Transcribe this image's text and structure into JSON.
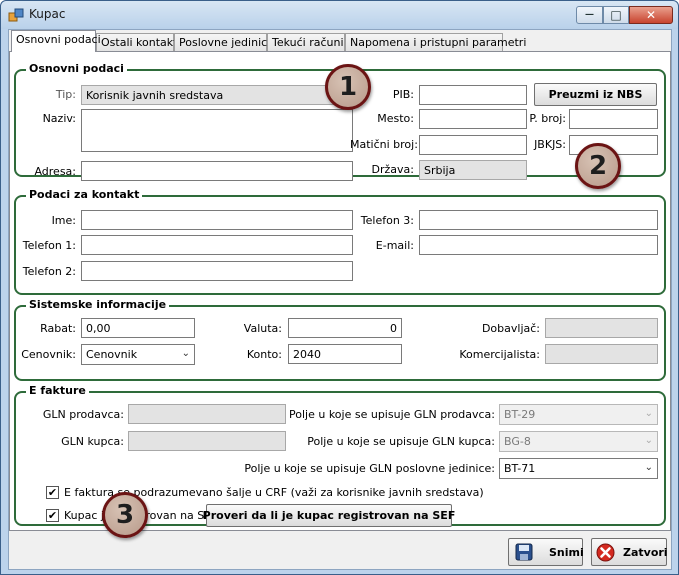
{
  "window": {
    "title": "Kupac",
    "minimize_glyph": "—",
    "maximize_glyph": "□",
    "close_glyph": "✕"
  },
  "tabs": [
    {
      "label": "Osnovni podaci",
      "active": true
    },
    {
      "label": "Ostali kontakti"
    },
    {
      "label": "Poslovne jedinice"
    },
    {
      "label": "Tekući računi"
    },
    {
      "label": "Napomena i pristupni parametri"
    }
  ],
  "osnovni": {
    "title": "Osnovni podaci",
    "tip_label": "Tip:",
    "tip_value": "Korisnik javnih sredstava",
    "naziv_label": "Naziv:",
    "naziv_value": "",
    "adresa_label": "Adresa:",
    "adresa_value": "",
    "pib_label": "PIB:",
    "pib_value": "",
    "mesto_label": "Mesto:",
    "mesto_value": "",
    "maticni_label": "Matični broj:",
    "maticni_value": "",
    "drzava_label": "Država:",
    "drzava_value": "Srbija",
    "pbroj_label": "P. broj:",
    "pbroj_value": "",
    "jbkjs_label": "JBKJS:",
    "jbkjs_value": "",
    "nbs_button": "Preuzmi iz NBS"
  },
  "kontakt": {
    "title": "Podaci za kontakt",
    "ime_label": "Ime:",
    "telefon1_label": "Telefon 1:",
    "telefon2_label": "Telefon 2:",
    "telefon3_label": "Telefon 3:",
    "email_label": "E-mail:"
  },
  "sistemske": {
    "title": "Sistemske informacije",
    "rabat_label": "Rabat:",
    "rabat_value": "0,00",
    "cenovnik_label": "Cenovnik:",
    "cenovnik_value": "Cenovnik",
    "valuta_label": "Valuta:",
    "valuta_value": "0",
    "konto_label": "Konto:",
    "konto_value": "2040",
    "dobavljac_label": "Dobavljač:",
    "komercijalista_label": "Komercijalista:"
  },
  "efakture": {
    "title": "E fakture",
    "gln_prodavca_label": "GLN prodavca:",
    "gln_kupca_label": "GLN kupca:",
    "polje_prodavca_label": "Polje u koje se upisuje GLN prodavca:",
    "polje_prodavca_value": "BT-29",
    "polje_kupca_label": "Polje u koje se upisuje GLN kupca:",
    "polje_kupca_value": "BG-8",
    "polje_pj_label": "Polje u koje se upisuje GLN poslovne jedinice:",
    "polje_pj_value": "BT-71",
    "crf_checkbox_label": "E faktura se podrazumevano šalje u CRF (važi za korisnike javnih sredstava)",
    "sef_checkbox_label": "Kupac je registrovan na SEF",
    "sef_button": "Proveri da li je kupac registrovan na SEF"
  },
  "footer": {
    "save_button": "Snimi",
    "close_button": "Zatvori"
  },
  "badges": [
    "1",
    "2",
    "3"
  ]
}
